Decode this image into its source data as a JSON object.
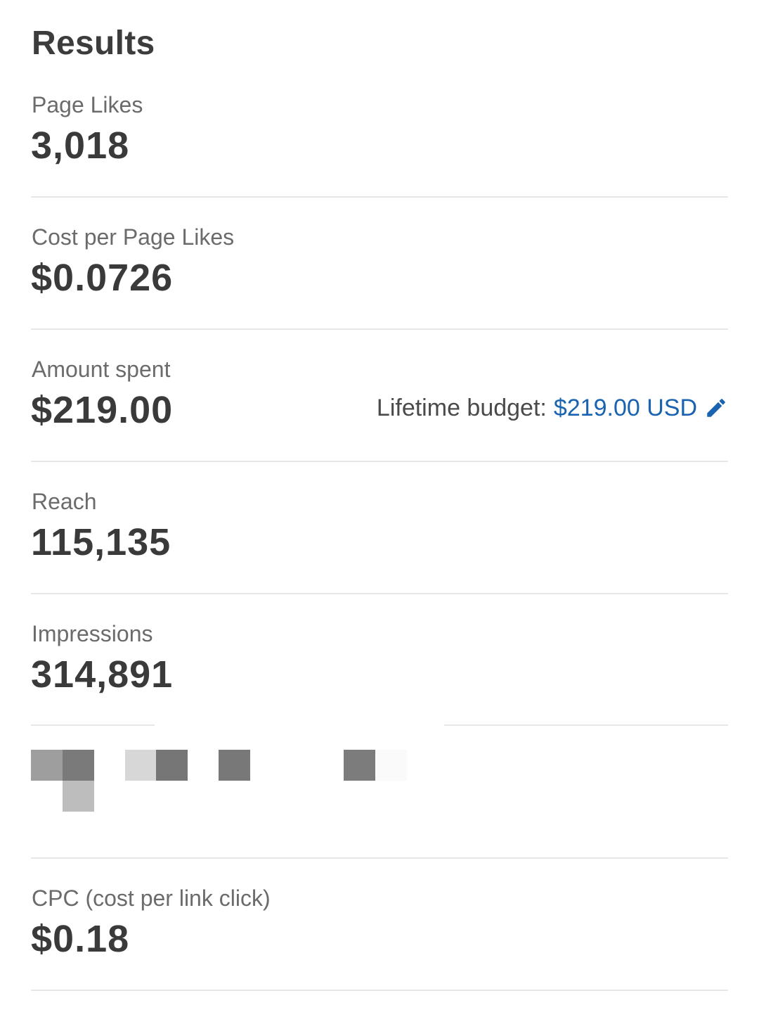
{
  "header": {
    "title": "Results"
  },
  "metrics": [
    {
      "label": "Page Likes",
      "value": "3,018"
    },
    {
      "label": "Cost per Page Likes",
      "value": "$0.0726"
    },
    {
      "label": "Amount spent",
      "value": "$219.00"
    },
    {
      "label": "Reach",
      "value": "115,135"
    },
    {
      "label": "Impressions",
      "value": "314,891"
    },
    {
      "label": "CPC (cost per link click)",
      "value": "$0.18"
    }
  ],
  "budget": {
    "label": "Lifetime budget:",
    "amount": "$219.00 USD",
    "icon": "pencil-edit-icon"
  },
  "redacted_block": {
    "icon": "pixelated-redaction"
  },
  "colors": {
    "text_primary": "#3a3a3a",
    "text_secondary": "#6b6b6b",
    "link": "#1a63b0",
    "divider": "#e7e7e7"
  }
}
